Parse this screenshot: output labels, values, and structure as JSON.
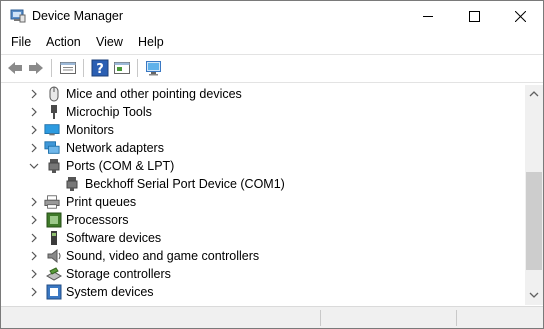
{
  "window": {
    "title": "Device Manager"
  },
  "menu": [
    "File",
    "Action",
    "View",
    "Help"
  ],
  "toolbar": {
    "buttons": [
      "back-arrow-icon",
      "forward-arrow-icon",
      "properties-view-icon",
      "help-icon",
      "update-driver-icon",
      "scan-hardware-icon"
    ]
  },
  "tree": {
    "items": [
      {
        "label": "Mice and other pointing devices",
        "icon": "mouse-icon",
        "expanded": false
      },
      {
        "label": "Microchip Tools",
        "icon": "usb-tool-icon",
        "expanded": false
      },
      {
        "label": "Monitors",
        "icon": "monitor-icon",
        "expanded": false
      },
      {
        "label": "Network adapters",
        "icon": "network-adapter-icon",
        "expanded": false
      },
      {
        "label": "Ports (COM & LPT)",
        "icon": "port-icon",
        "expanded": true
      },
      {
        "label": "Beckhoff Serial Port Device (COM1)",
        "icon": "port-icon",
        "child": true
      },
      {
        "label": "Print queues",
        "icon": "printer-icon",
        "expanded": false
      },
      {
        "label": "Processors",
        "icon": "processor-icon",
        "expanded": false
      },
      {
        "label": "Software devices",
        "icon": "software-device-icon",
        "expanded": false
      },
      {
        "label": "Sound, video and game controllers",
        "icon": "speaker-icon",
        "expanded": false
      },
      {
        "label": "Storage controllers",
        "icon": "storage-controller-icon",
        "expanded": false
      },
      {
        "label": "System devices",
        "icon": "system-device-icon",
        "expanded": false
      }
    ]
  },
  "colors": {
    "accent": "#3a78c3",
    "monitor": "#2d9be0",
    "processor": "#3f7a2a"
  }
}
